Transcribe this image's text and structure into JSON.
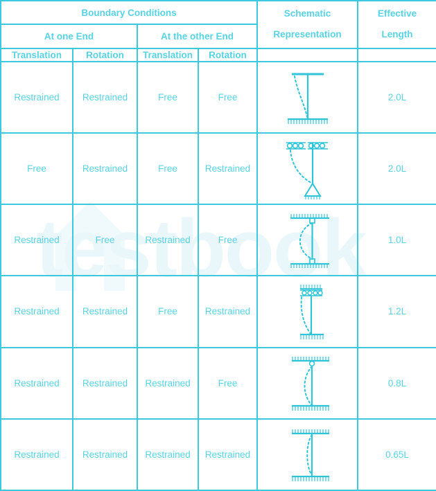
{
  "colors": {
    "header_text": "#16bcd4",
    "body_text": "#4ccfe0",
    "border": "#3cc9dd",
    "schematic": "#2fc4d8",
    "watermark": "#eaf7fa",
    "background": "#ffffff"
  },
  "watermark": {
    "text": "testbook"
  },
  "header": {
    "boundary_conditions": "Boundary Conditions",
    "schematic_representation_line1": "Schematic",
    "schematic_representation_line2": "Representation",
    "effective_length_line1": "Effective",
    "effective_length_line2": "Length",
    "at_one_end": "At one End",
    "at_the_other_end": "At the other End",
    "sub": [
      "Translation",
      "Rotation",
      "Translation",
      "Rotation"
    ]
  },
  "rows": [
    {
      "one_end_translation": "Restrained",
      "one_end_rotation": "Restrained",
      "other_end_translation": "Free",
      "other_end_rotation": "Free",
      "effective_length": "2.0L",
      "schematic": "fixed-base-free-top-guide"
    },
    {
      "one_end_translation": "Free",
      "one_end_rotation": "Restrained",
      "other_end_translation": "Free",
      "other_end_rotation": "Restrained",
      "effective_length": "2.0L",
      "schematic": "roller-top-pin-bottom"
    },
    {
      "one_end_translation": "Restrained",
      "one_end_rotation": "Free",
      "other_end_translation": "Restrained",
      "other_end_rotation": "Free",
      "effective_length": "1.0L",
      "schematic": "pinned-both-ends"
    },
    {
      "one_end_translation": "Restrained",
      "one_end_rotation": "Restrained",
      "other_end_translation": "Free",
      "other_end_rotation": "Restrained",
      "effective_length": "1.2L",
      "schematic": "guided-top-fixed-bottom"
    },
    {
      "one_end_translation": "Restrained",
      "one_end_rotation": "Restrained",
      "other_end_translation": "Restrained",
      "other_end_rotation": "Free",
      "effective_length": "0.8L",
      "schematic": "pin-top-fixed-bottom"
    },
    {
      "one_end_translation": "Restrained",
      "one_end_rotation": "Restrained",
      "other_end_translation": "Restrained",
      "other_end_rotation": "Restrained",
      "effective_length": "0.65L",
      "schematic": "fixed-both-ends"
    }
  ]
}
